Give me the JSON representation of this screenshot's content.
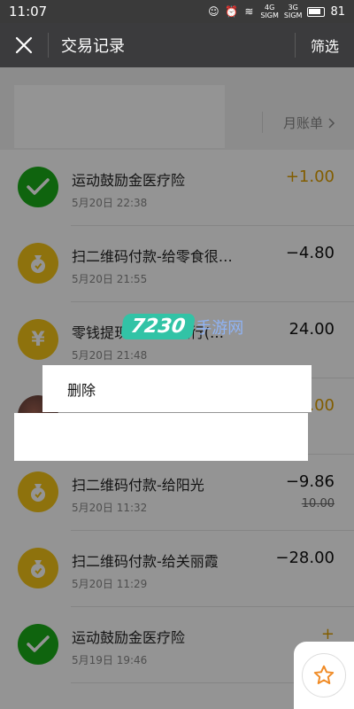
{
  "status_bar": {
    "time": "11:07",
    "net1": "4G",
    "net2": "3G",
    "signal_label": "SIGM",
    "battery": "81"
  },
  "nav": {
    "title": "交易记录",
    "filter_label": "筛选"
  },
  "month_header": {
    "bill_label": "月账单"
  },
  "transactions": [
    {
      "title": "运动鼓励金医疗险",
      "time": "5月20日  22:38",
      "amount": "+1.00",
      "type": "income",
      "icon": "wechat-pay-icon"
    },
    {
      "title": "扫二维码付款-给零食很…",
      "time": "5月20日  21:55",
      "amount": "−4.80",
      "type": "expense",
      "icon": "money-bag-icon"
    },
    {
      "title": "零钱提现-到招商银行(…",
      "time": "5月20日  21:48",
      "amount": "24.00",
      "type": "expense",
      "icon": "yen-coin-icon"
    },
    {
      "title": "",
      "time": "",
      "amount": "+.00",
      "type": "income",
      "icon": "photo-avatar"
    },
    {
      "title": "扫二维码付款-给阳光",
      "time": "5月20日  11:32",
      "amount": "−9.86",
      "original": "10.00",
      "type": "expense",
      "icon": "money-bag-icon"
    },
    {
      "title": "扫二维码付款-给关丽霞",
      "time": "5月20日  11:29",
      "amount": "−28.00",
      "type": "expense",
      "icon": "money-bag-icon"
    },
    {
      "title": "运动鼓励金医疗险",
      "time": "5月19日  19:46",
      "amount": "+",
      "type": "income",
      "icon": "wechat-pay-icon"
    }
  ],
  "popup": {
    "delete_label": "删除"
  },
  "watermark": {
    "badge": "7230",
    "text": "手游网"
  },
  "colors": {
    "income": "#e0a000",
    "wechat_green": "#1aad19",
    "coin_yellow": "#f5c518",
    "nav_bg": "#3b3b3d"
  }
}
